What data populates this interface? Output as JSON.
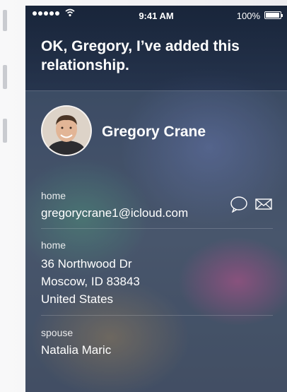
{
  "status_bar": {
    "time": "9:41 AM",
    "battery": "100%"
  },
  "siri": {
    "message": "OK, Gregory, I’ve added this relationship."
  },
  "contact": {
    "name": "Gregory Crane",
    "email": {
      "label": "home",
      "value": "gregorycrane1@icloud.com"
    },
    "address": {
      "label": "home",
      "line1": "36 Northwood Dr",
      "line2": "Moscow, ID 83843",
      "line3": "United States"
    },
    "relation": {
      "label": "spouse",
      "value": "Natalia Maric"
    }
  },
  "icons": {
    "message": "message-bubble-icon",
    "mail": "mail-envelope-icon",
    "wifi": "wifi-icon",
    "battery": "battery-icon"
  }
}
